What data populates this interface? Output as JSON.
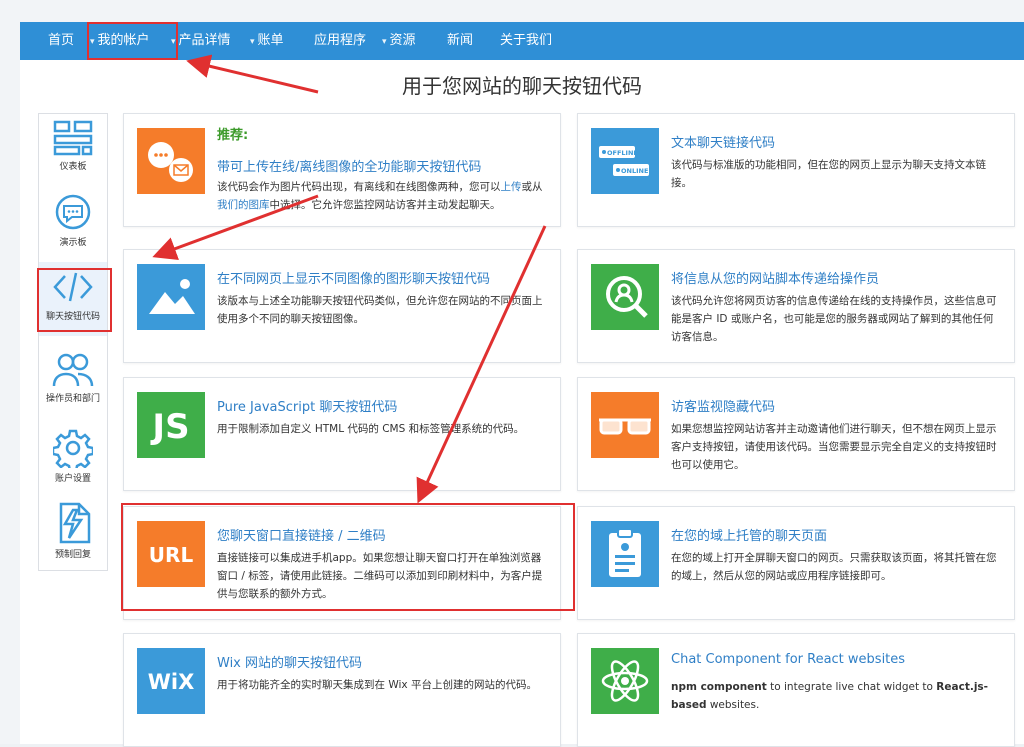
{
  "nav": {
    "items": [
      {
        "label": "首页",
        "caret": false
      },
      {
        "label": "我的帐户",
        "caret": true
      },
      {
        "label": "产品详情",
        "caret": true
      },
      {
        "label": "账单",
        "caret": true
      },
      {
        "label": "应用程序",
        "caret": false
      },
      {
        "label": "资源",
        "caret": true
      },
      {
        "label": "新闻",
        "caret": false
      },
      {
        "label": "关于我们",
        "caret": false
      }
    ]
  },
  "page": {
    "title": "用于您网站的聊天按钮代码"
  },
  "sidebar": {
    "items": [
      {
        "label": "仪表板",
        "icon": "dashboard-icon"
      },
      {
        "label": "演示板",
        "icon": "chat-bubble-icon"
      },
      {
        "label": "聊天按钮代码",
        "icon": "code-icon"
      },
      {
        "label": "操作员和部门",
        "icon": "users-icon"
      },
      {
        "label": "账户设置",
        "icon": "gear-icon"
      },
      {
        "label": "预制回复",
        "icon": "lightning-document-icon"
      }
    ]
  },
  "cards": [
    {
      "badge": "推荐:",
      "title": "带可上传在线/离线图像的全功能聊天按钮代码",
      "desc_parts": [
        "该代码会作为图片代码出现，有离线和在线图像两种，您可以",
        "上传",
        "或从",
        "我们的图库",
        "中选择。它允许您监控网站访客并主动发起聊天。"
      ],
      "icon": "chat-mail-icon",
      "color": "#f57c2a"
    },
    {
      "title": "文本聊天链接代码",
      "desc": "该代码与标准版的功能相同，但在您的网页上显示为聊天支持文本链接。",
      "icon": "offline-online-icon",
      "color": "#3b9ad9",
      "tile_text": [
        "OFFLINE",
        "ONLINE"
      ]
    },
    {
      "title": "在不同网页上显示不同图像的图形聊天按钮代码",
      "desc": "该版本与上述全功能聊天按钮代码类似，但允许您在网站的不同页面上使用多个不同的聊天按钮图像。",
      "icon": "image-icon",
      "color": "#3b9ad9"
    },
    {
      "title": "将信息从您的网站脚本传递给操作员",
      "desc": "该代码允许您将网页访客的信息传递给在线的支持操作员，这些信息可能是客户 ID 或账户名，也可能是您的服务器或网站了解到的其他任何访客信息。",
      "icon": "search-user-icon",
      "color": "#3fae49"
    },
    {
      "title": "Pure JavaScript 聊天按钮代码",
      "desc": "用于限制添加自定义 HTML 代码的 CMS 和标签管理系统的代码。",
      "icon": "js-icon",
      "color": "#3fae49",
      "tile_text": "JS"
    },
    {
      "title": "访客监视隐藏代码",
      "desc": "如果您想监控网站访客并主动邀请他们进行聊天，但不想在网页上显示客户支持按钮，请使用该代码。当您需要显示完全自定义的支持按钮时也可以使用它。",
      "icon": "glasses-icon",
      "color": "#f57c2a"
    },
    {
      "title": "您聊天窗口直接链接 / 二维码",
      "desc": "直接链接可以集成进手机app。如果您想让聊天窗口打开在单独浏览器窗口 / 标签，请使用此链接。二维码可以添加到印刷材料中，为客户提供与您联系的额外方式。",
      "icon": "url-icon",
      "color": "#f57c2a",
      "tile_text": "URL"
    },
    {
      "title": "在您的域上托管的聊天页面",
      "desc": "在您的域上打开全屏聊天窗口的网页。只需获取该页面，将其托管在您的域上，然后从您的网站或应用程序链接即可。",
      "icon": "clipboard-icon",
      "color": "#3b9ad9"
    },
    {
      "title": "Wix 网站的聊天按钮代码",
      "desc": "用于将功能齐全的实时聊天集成到在 Wix 平台上创建的网站的代码。",
      "icon": "wix-icon",
      "color": "#3b9ad9",
      "tile_text": "WiX"
    },
    {
      "title": "Chat Component for React websites",
      "desc_parts": [
        "npm component",
        " to integrate live chat widget to ",
        "React.js-based",
        " websites."
      ],
      "icon": "react-icon",
      "color": "#3fae49"
    }
  ],
  "colors": {
    "nav": "#2f8fd6",
    "link": "#2f7fc6",
    "orange": "#f57c2a",
    "blue": "#3b9ad9",
    "green": "#3fae49",
    "annotation": "#e03030"
  }
}
